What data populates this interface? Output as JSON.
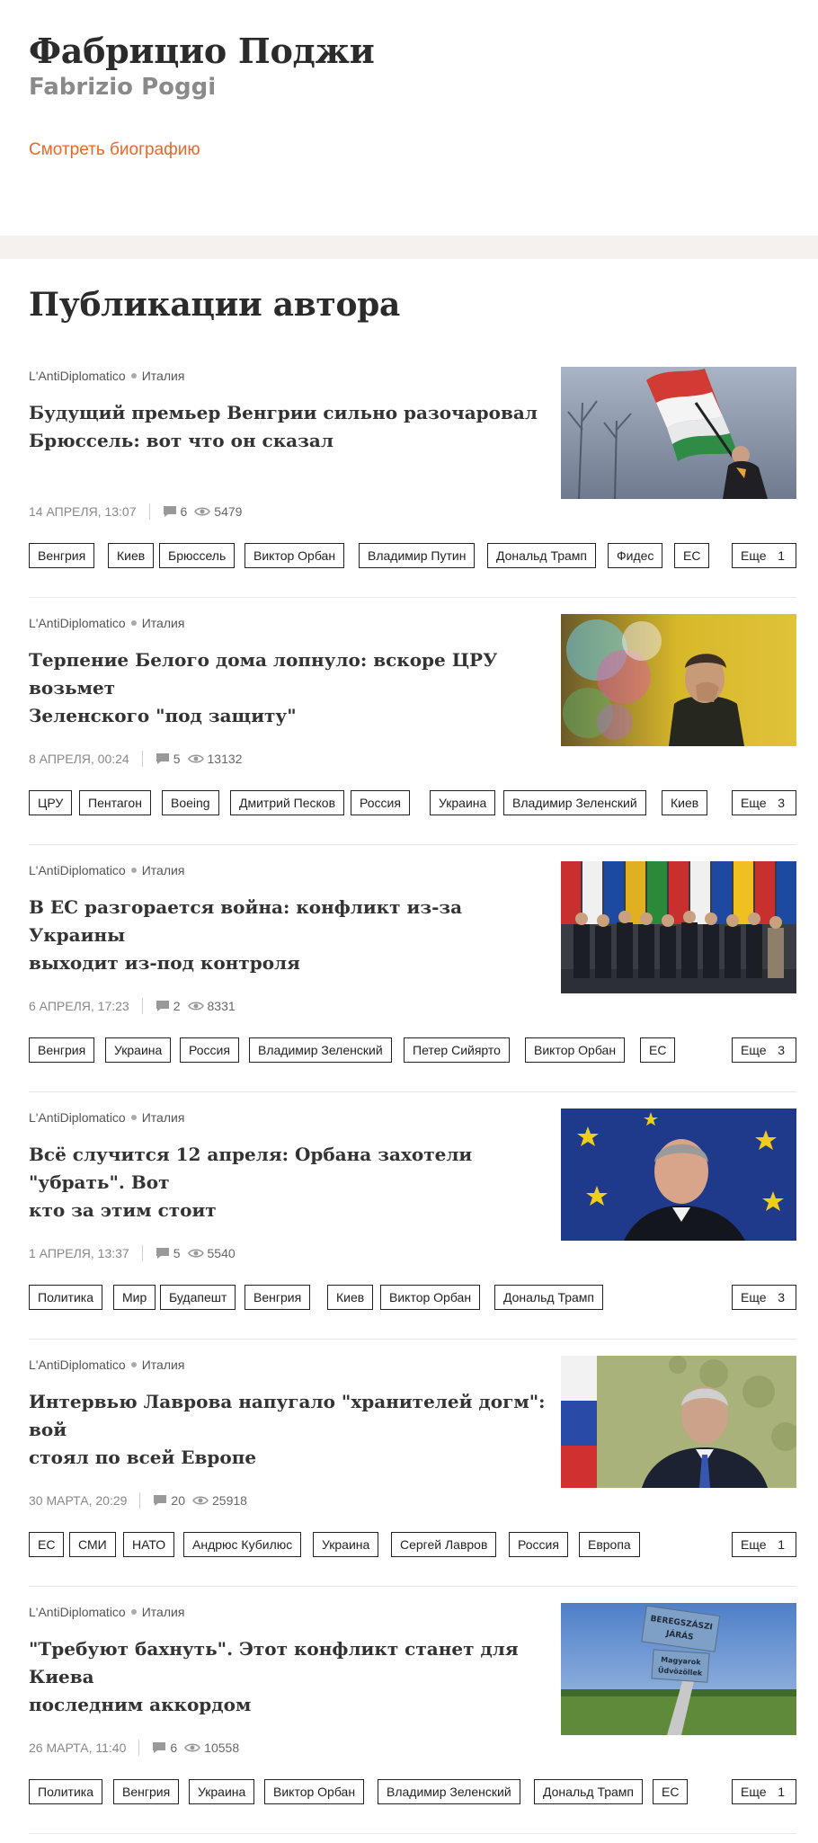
{
  "author": {
    "name_ru": "Фабрицио Поджи",
    "name_en": "Fabrizio Poggi",
    "bio_link": "Смотреть биографию"
  },
  "section_title": "Публикации автора",
  "more_label": "Еще",
  "articles": [
    {
      "source": "L'AntiDiplomatico",
      "country": "Италия",
      "headline_lines": [
        "Будущий премьер Венгрии сильно разочаровал",
        "Брюссель: вот что он сказал"
      ],
      "date": "14 АПРЕЛЯ, 13:07",
      "comments": "6",
      "views": "5479",
      "tags": [
        "Венгрия",
        "Киев",
        "Брюссель",
        "Виктор Орбан",
        "Владимир Путин",
        "Дональд Трамп",
        "Фидес",
        "ЕС"
      ],
      "more_count": "1"
    },
    {
      "source": "L'AntiDiplomatico",
      "country": "Италия",
      "headline_lines": [
        "Терпение Белого дома лопнуло: вскоре ЦРУ возьмет",
        "Зеленского \"под защиту\""
      ],
      "date": "8 АПРЕЛЯ, 00:24",
      "comments": "5",
      "views": "13132",
      "tags": [
        "ЦРУ",
        "Пентагон",
        "Boeing",
        "Дмитрий Песков",
        "Россия",
        "Украина",
        "Владимир Зеленский",
        "Киев"
      ],
      "more_count": "3"
    },
    {
      "source": "L'AntiDiplomatico",
      "country": "Италия",
      "headline_lines": [
        "В ЕС разгорается война: конфликт из-за Украины",
        "выходит из-под контроля"
      ],
      "date": "6 АПРЕЛЯ, 17:23",
      "comments": "2",
      "views": "8331",
      "tags": [
        "Венгрия",
        "Украина",
        "Россия",
        "Владимир Зеленский",
        "Петер Сийярто",
        "Виктор Орбан",
        "ЕС"
      ],
      "more_count": "3"
    },
    {
      "source": "L'AntiDiplomatico",
      "country": "Италия",
      "headline_lines": [
        "Всё случится 12 апреля: Орбана захотели \"убрать\". Вот",
        "кто за этим стоит"
      ],
      "date": "1 АПРЕЛЯ, 13:37",
      "comments": "5",
      "views": "5540",
      "tags": [
        "Политика",
        "Мир",
        "Будапешт",
        "Венгрия",
        "Киев",
        "Виктор Орбан",
        "Дональд Трамп"
      ],
      "more_count": "3"
    },
    {
      "source": "L'AntiDiplomatico",
      "country": "Италия",
      "headline_lines": [
        "Интервью Лаврова напугало \"хранителей догм\": вой",
        "стоял по всей Европе"
      ],
      "date": "30 МАРТА, 20:29",
      "comments": "20",
      "views": "25918",
      "tags": [
        "ЕС",
        "СМИ",
        "НАТО",
        "Андрюс Кубилюс",
        "Украина",
        "Сергей Лавров",
        "Россия",
        "Европа"
      ],
      "more_count": "1"
    },
    {
      "source": "L'AntiDiplomatico",
      "country": "Италия",
      "headline_lines": [
        "\"Требуют бахнуть\". Этот конфликт станет для Киева",
        "последним аккордом"
      ],
      "date": "26 МАРТА, 11:40",
      "comments": "6",
      "views": "10558",
      "tags": [
        "Политика",
        "Венгрия",
        "Украина",
        "Виктор Орбан",
        "Владимир Зеленский",
        "Дональд Трамп",
        "ЕС"
      ],
      "more_count": "1",
      "image_sign": [
        "BEREGSZÁSZI",
        "JÁRÁS",
        "Magyarok",
        "Üdvözöllek"
      ]
    }
  ]
}
